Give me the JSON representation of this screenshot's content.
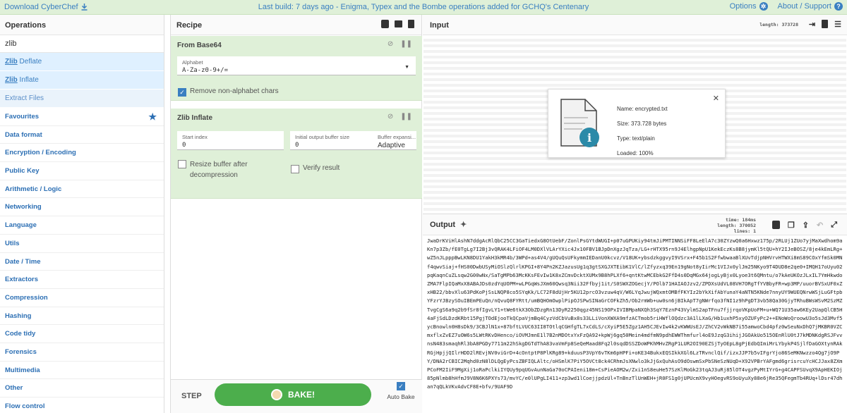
{
  "banner": {
    "download_label": "Download CyberChef",
    "status": "Last build: 7 days ago - Enigma, Typex and the Bombe operations added for GCHQ's Centenary",
    "options_label": "Options",
    "about_label": "About / Support",
    "color": "#dff0d8"
  },
  "operations": {
    "title": "Operations",
    "search_value": "zlib",
    "results": [
      {
        "match": "Zlib",
        "rest": " Deflate"
      },
      {
        "match": "Zlib",
        "rest": " Inflate"
      }
    ],
    "extract_files": "Extract Files",
    "categories": [
      "Favourites",
      "Data format",
      "Encryption / Encoding",
      "Public Key",
      "Arithmetic / Logic",
      "Networking",
      "Language",
      "Utils",
      "Date / Time",
      "Extractors",
      "Compression",
      "Hashing",
      "Code tidy",
      "Forensics",
      "Multimedia",
      "Other",
      "Flow control"
    ]
  },
  "recipe": {
    "title": "Recipe",
    "op1": {
      "name": "From Base64",
      "alphabet_label": "Alphabet",
      "alphabet_value": "A-Za-z0-9+/=",
      "remove_label": "Remove non-alphabet chars",
      "remove_checked": true
    },
    "op2": {
      "name": "Zlib Inflate",
      "start_label": "Start index",
      "start_value": "0",
      "initbuf_label": "Initial output buffer size",
      "initbuf_value": "0",
      "buftype_label": "Buffer expansi...",
      "buftype_value": "Adaptive",
      "resize_label": "Resize buffer after decompression",
      "verify_label": "Verify result"
    },
    "step_label": "STEP",
    "bake_label": "BAKE!",
    "autobake_label": "Auto Bake",
    "autobake_checked": true
  },
  "input": {
    "title": "Input",
    "length_text": "length: 373728",
    "file": {
      "name": "Name: encrypted.txt",
      "size": "Size: 373.728 bytes",
      "type": "Type: text/plain",
      "loaded": "Loaded: 100%"
    }
  },
  "output": {
    "title": "Output",
    "time": "time:  184ms",
    "length": "length: 370052",
    "lines": "lines:    1",
    "text": "JwaDrKViHlAshN7ddgAcRlQbC25CC3GaTiedxG8OtUebF/ZonlPsGYtdWUGI+p07uGPUKiy94tmJiPMTINNSiFF8LeElA7c30ZYzwQ0a6Hxwz175p/2RLUj1ZUo7yjMaXwdhom9aKn7p3Zb/fE0TgLg7I2Bj3vQRAK4LFiOF4LM0DXlVLArYXic4Jx10FBV1BJpDnXgzJqTza/LG+rHTX95rn9J4ElhgpNpU1KekEczKs8B8jymKl5tQU+hY2IJeBOSZ/8je4kEmLRg+wZ5nJLpppBwLKN8DU1YakH3kMR4b/3WPd+as4V4/gUQuQsUFkymmIEDanU0kcvz/V18UK+ybsdzkggvyI9VSrx+F45b1S2FfwbwaaBlXUvTdjpNHVrvHTWXi8mS89COxYfmSk0MNf4qwvSiaj+fHS00DwbUSyMiOSlzQlrlKPGI+8Y4Pn2KZJazusUg1q3gtSXGJXTEibK1VlC/lZfyzxq39En19gNot8yIirMc1VIJx0ylJm25NKyo9T4DUD8e2qe0+IMQH17oUyu02pqKaqnCuZLsqw2G00wNx/SaTgMPb63McKKsFEvIw1K8xZCmvDcktXUMx9B8hPLXf6+qntKtwMCEbkG2FfD4s0DqMGx64jogLyBjx0Lyoe3t6QMntu/o7kAeUKOzJLxIL7YmHkwdoZMA7FlpIQaMxX8ABAJDs0zdYqUOPM+wLPGqWsJXm60Qwsq3Nii32Ffbyj1it/S0SWXZOGecjY/POlb71HAIAOJzv2/ZPDXsUdVL08VH7ORgTfYVBbyFR+wp3MP/uuorBVSxUF0xZxHB22/bbvXlu63PdKoPjSsLNQP8co5SYqKk/LC72F8dUjHr5KU12prcO3vzuw4qV/W6LYqJwujWQxmtOMBfFKYIz2bYkXifAbYunaY4aNTN5KNde7nnyUY9WUEQNrwWSjLuGFtpbYFzrYJBzySOuIBEmPEuQn/nQvuQ8FYRtt/umBQHOmOwplPipOJSPwSINaGrCOFkZh5/Ob2rmWb+uw0sn6jBIkApT7gNWrfqo3fNI1z9hPgDT3vb58Qa30GjyTRhuBWsWSvM2SzMZTvgCgS6a9q2b9fSr8fIgvLY1+tWe6tkX3ObZDzgRn13DyR2250qgz45NS19OPxIVIBMpaNXQh3SqY7EznP43VylmS2apTFnu7fjjrqoVKpUoFM+u+WQ71U35aw6KEy2UapQlCB5H4aFjSdLDzdKRbt15PgjTOdEjooTkQCpaVjmBq4CyzVdCbVuBx8s33LLiVonXWXA9mfzACTmob5riHWflOQdzc3A1lLXaG/Hb1uxhP5xyOZUFyPc2++ENoWoQroowU3o5sJd3Mvf5ycBnowln0H8sDk9/3CBJlN1x+87bftLVUC63II8TOtlqCGHfgTL7xCdLS/cXyiP5E5Zgz1AH5CJEvIw4k2vKWWUsEJ/ZhCV2vWkNB7i55amwoCbd4pfz0wSeuNxDhQ7jMKBR0VZCmxflxZvEZ7uOW6s5LWtRKvDHenco/iOVMJmnE1l7B2nMDOtxYxFzQA92+kpWj6gq50Mein4mdfmN9pdhEWWThmfurl4oE9JzqG3ihijJGOAkUo515OEnRlU0tJ7kMDNKdgRSJFvvnsN483smaqhRl3bA8PGDy7711m22hSkgDGTdThA83vaVmFp8SeQeMaad8Fq2l0sqdDSSZDoWPKhMHvZRgP1LUR2OI90EZSjTyOEpL8gPjEdbQImiMrLYbykP4SjlfDaGOXtynRAkRGjHpjjQIlrHDD2lREvjNV0viGrD+4cOntptP8PlKRg89+kduusP3VpY6vTKm6pHPFi+oKE34BukxEQSIkkXGl6LzTRvnclQif/izxJJP7b5vIFgrYjo86SeMKNwzzo4Qg7jO9PY/DNA2rCBIC2Mqhd0zN8lDLQgEyPcsZBFIQLAltc/oHSmlK7PiY5OVCt8ck4CRhmJsXNwlo3kJjGxQuhAsO9dOswmSxPbSNeSzNUqD+X92VPBrYAFgmd6grisrcuYcHCJJax8ZXmPCoFM2IiF9MgXij1oRaPclkiIYQUy9pqUGvAunNaGa70oCPAIeni18m+CsPieAOM2w/Zxi1nS8euHe57SzKlMoGk23tqAJ3uRj85lOT4vgzPyMtIYrG+g4CAPFSUvqX9ApHEKIOj85pNlmb8hHfmJ9V8N6K6PXYs73/mvYC/e0lUPgLI411+zp3wd1lCoejjpdzUl+TnBnzTlUnWEH+jR0FS1g0jUPUcmX9vyHOegvRS9oUyuXy88e6jRe35QFegmTb4RUq+lDsr47dhan7qQLkVKvAdvCF8E+bfv/9UAF9D"
  }
}
